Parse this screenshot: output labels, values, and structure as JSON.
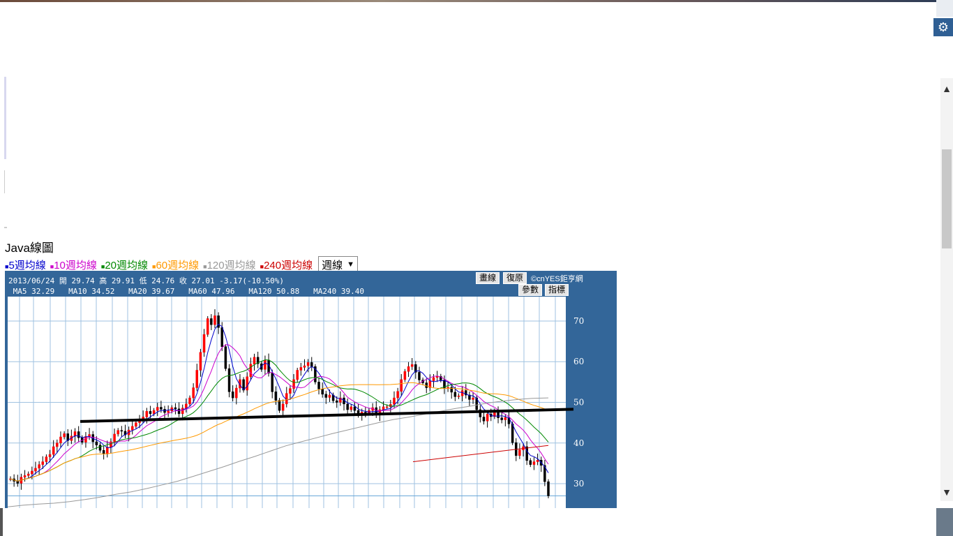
{
  "page": {
    "title": "Java線圖",
    "settings_icon": "gear-icon"
  },
  "legend": {
    "items": [
      {
        "label": "5週均線",
        "color": "#0000cc"
      },
      {
        "label": "10週均線",
        "color": "#cc00cc"
      },
      {
        "label": "20週均線",
        "color": "#008800"
      },
      {
        "label": "60週均線",
        "color": "#ff9900"
      },
      {
        "label": "120週均線",
        "color": "#999999"
      },
      {
        "label": "240週均線",
        "color": "#cc0000"
      }
    ],
    "period_selected": "週線"
  },
  "toolbar": {
    "draw_label": "畫線",
    "reset_label": "復原",
    "params_label": "參數",
    "indicator_label": "指標",
    "copyright": "©cnYES鉅亨網"
  },
  "info": {
    "quote": "2013/06/24 開 29.74 高 29.91 低 24.76 收 27.01 -3.17(-10.50%)",
    "ma": " MA5 32.29   MA10 34.52   MA20 39.67   MA60 47.96   MA120 50.88   MA240 39.40"
  },
  "colors": {
    "panel_bg": "#336699",
    "up_candle": "#ff0000",
    "down_candle": "#000000",
    "ma5": "#0000cc",
    "ma10": "#cc00cc",
    "ma20": "#008800",
    "ma60": "#ff9900",
    "ma120": "#999999",
    "ma240": "#cc0000",
    "support_line": "#000000"
  },
  "chart_data": {
    "type": "candlestick",
    "ylim": [
      24,
      76
    ],
    "y_ticks": [
      30,
      40,
      50,
      60,
      70
    ],
    "close_weekly": [
      31.2,
      30.6,
      30.1,
      31.6,
      32.0,
      32.4,
      33.1,
      33.8,
      34.7,
      35.4,
      36.6,
      37.2,
      39.1,
      40.0,
      41.5,
      42.3,
      40.6,
      41.7,
      42.8,
      41.3,
      40.2,
      41.6,
      42.1,
      40.3,
      39.5,
      38.2,
      37.3,
      39.0,
      40.3,
      42.2,
      43.1,
      42.9,
      42.0,
      43.2,
      44.1,
      45.0,
      45.8,
      46.4,
      47.8,
      47.2,
      48.0,
      48.8,
      48.3,
      47.5,
      47.9,
      48.7,
      48.4,
      47.2,
      48.6,
      49.6,
      51.1,
      53.6,
      57.9,
      62.3,
      66.7,
      70.6,
      69.1,
      71.3,
      68.4,
      63.7,
      58.3,
      52.6,
      51.1,
      53.5,
      55.6,
      53.0,
      56.3,
      59.4,
      61.1,
      59.5,
      58.1,
      60.4,
      57.2,
      52.6,
      50.5,
      48.0,
      49.6,
      52.2,
      53.4,
      55.6,
      57.9,
      58.6,
      59.0,
      59.8,
      58.8,
      55.0,
      53.3,
      52.0,
      51.2,
      51.8,
      50.4,
      50.0,
      51.1,
      49.6,
      48.2,
      48.9,
      48.0,
      47.1,
      47.6,
      47.4,
      48.0,
      48.7,
      47.0,
      48.2,
      48.9,
      48.9,
      49.5,
      51.1,
      52.7,
      55.6,
      57.6,
      58.8,
      59.3,
      57.4,
      55.5,
      54.8,
      53.6,
      55.3,
      56.1,
      56.4,
      55.5,
      53.4,
      53.7,
      52.5,
      51.4,
      51.6,
      52.9,
      51.8,
      50.7,
      51.1,
      48.2,
      46.4,
      45.4,
      47.1,
      46.5,
      47.9,
      46.2,
      45.7,
      46.3,
      44.7,
      40.1,
      36.9,
      38.3,
      39.1,
      35.7,
      34.7,
      35.4,
      35.8,
      34.5,
      30.5,
      27.01
    ],
    "ma120_approx": [
      24.3,
      24.7,
      25.0,
      25.2,
      25.6,
      26.1,
      26.7,
      27.4,
      28.0,
      28.8,
      29.7,
      30.6,
      31.8,
      33.0,
      34.2,
      35.5,
      36.7,
      38.0,
      39.3,
      40.3,
      41.3,
      42.3,
      43.2,
      44.1,
      45.0,
      45.8,
      46.4,
      47.1,
      47.8,
      48.5,
      49.1,
      49.8,
      50.3,
      50.7,
      51.0,
      51.1
    ],
    "support_line": {
      "from": 45.3,
      "to": 48.3
    },
    "ma240_visible": {
      "from": 35.4,
      "to": 39.4
    }
  }
}
